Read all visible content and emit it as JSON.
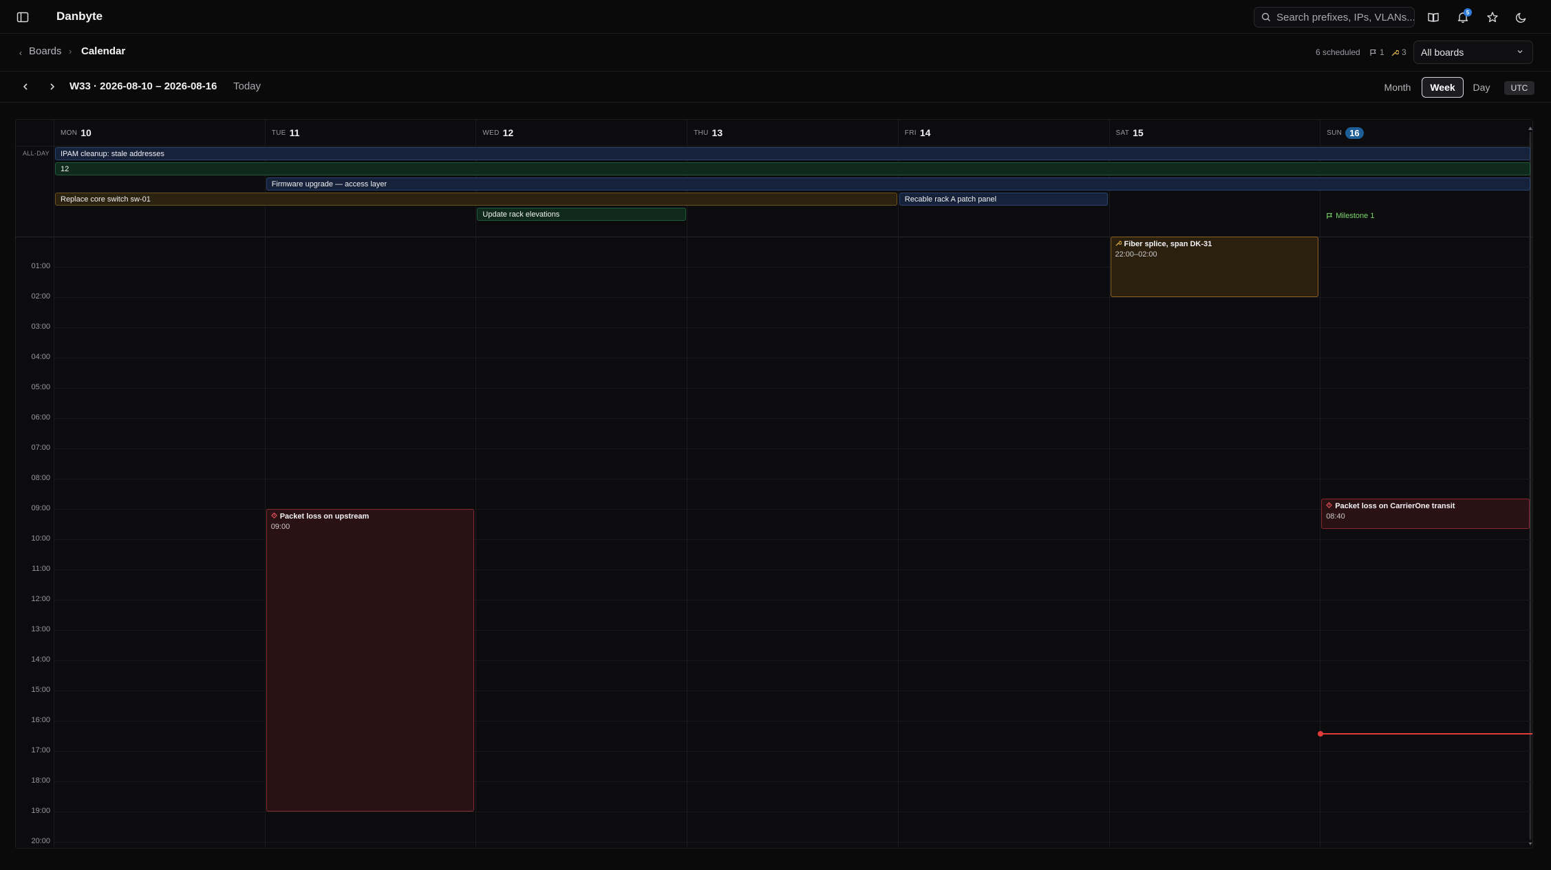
{
  "app": {
    "title": "Danbyte"
  },
  "search": {
    "placeholder": "Search prefixes, IPs, VLANs..."
  },
  "notifications": {
    "count": "5"
  },
  "breadcrumb": {
    "back": "‹",
    "parent": "Boards",
    "separator": "›",
    "current": "Calendar"
  },
  "summary": {
    "scheduled": "6 scheduled",
    "milestones": "1",
    "maintenance": "3"
  },
  "board_filter": {
    "selected": "All boards"
  },
  "nav": {
    "week_title": "W33 · 2026-08-10 – 2026-08-16",
    "today": "Today"
  },
  "views": {
    "month": "Month",
    "week": "Week",
    "day": "Day",
    "timezone": "UTC",
    "active": "Week"
  },
  "calendar": {
    "allday_label": "ALL-DAY",
    "days": [
      {
        "dow": "MON",
        "num": "10"
      },
      {
        "dow": "TUE",
        "num": "11"
      },
      {
        "dow": "WED",
        "num": "12"
      },
      {
        "dow": "THU",
        "num": "13"
      },
      {
        "dow": "FRI",
        "num": "14"
      },
      {
        "dow": "SAT",
        "num": "15"
      },
      {
        "dow": "SUN",
        "num": "16",
        "today": true
      }
    ],
    "hours": [
      "01:00",
      "02:00",
      "03:00",
      "04:00",
      "05:00",
      "06:00",
      "07:00",
      "08:00",
      "09:00",
      "10:00",
      "11:00",
      "12:00",
      "13:00",
      "14:00",
      "15:00",
      "16:00",
      "17:00",
      "18:00",
      "19:00",
      "20:00"
    ],
    "allday_events": [
      {
        "title": "IPAM cleanup: stale addresses",
        "color": "blue",
        "start_day": "MON",
        "end_day": "SUN"
      },
      {
        "title": "12",
        "color": "green",
        "start_day": "MON",
        "end_day": "SUN"
      },
      {
        "title": "Firmware upgrade — access layer",
        "color": "blue",
        "start_day": "TUE",
        "end_day": "SUN"
      },
      {
        "title": "Replace core switch sw-01",
        "color": "amber",
        "start_day": "MON",
        "end_day": "THU"
      },
      {
        "title": "Recable rack A patch panel",
        "color": "blue",
        "start_day": "FRI",
        "end_day": "FRI"
      },
      {
        "title": "Update rack elevations",
        "color": "green",
        "start_day": "WED",
        "end_day": "WED"
      }
    ],
    "milestone": {
      "label": "Milestone 1",
      "day": "SUN"
    },
    "timed_events": [
      {
        "title": "Fiber splice, span DK-31",
        "time": "22:00–02:00",
        "color": "amber",
        "day": "SAT",
        "icon": "wrench-icon"
      },
      {
        "title": "Packet loss on upstream",
        "time": "09:00",
        "color": "red",
        "day": "TUE",
        "icon": "alert-icon"
      },
      {
        "title": "Packet loss on CarrierOne transit",
        "time": "08:40",
        "color": "red",
        "day": "SUN",
        "icon": "alert-icon"
      }
    ],
    "now_time": "16:25",
    "colors": {
      "accent": "#1d5e99",
      "now": "#e23b3b",
      "milestone": "#7bd86c"
    }
  }
}
